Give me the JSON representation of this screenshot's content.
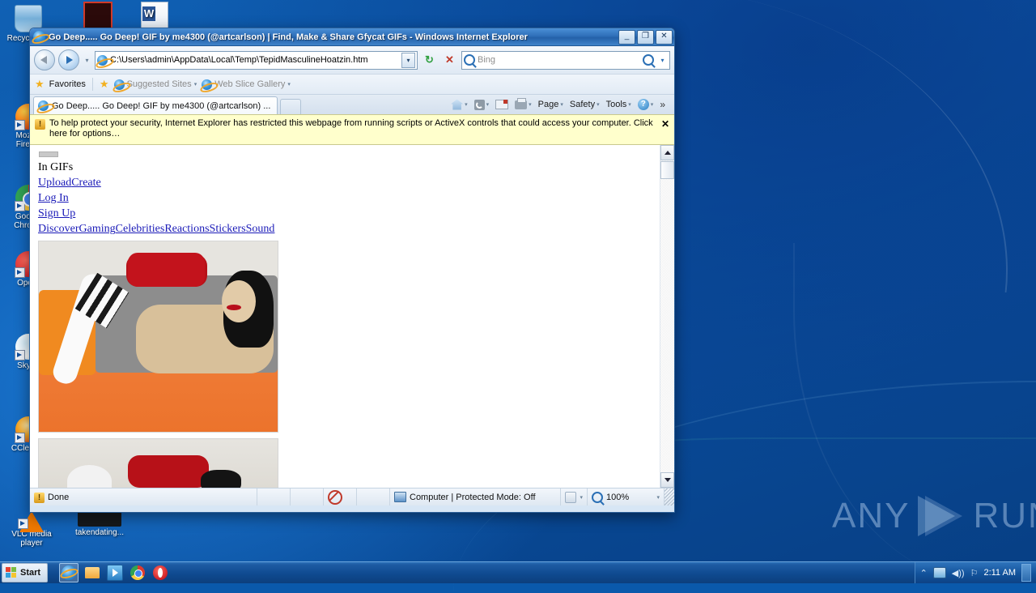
{
  "window": {
    "title": "Go Deep..... Go Deep! GIF by me4300 (@artcarlson) | Find, Make & Share Gfycat GIFs - Windows Internet Explorer",
    "minimize_label": "_",
    "maximize_label": "❐",
    "close_label": "✕"
  },
  "toolbar": {
    "back_tooltip": "Back",
    "forward_tooltip": "Forward",
    "recent_pages_caret": "▾",
    "address_value": "C:\\Users\\admin\\AppData\\Local\\Temp\\TepidMasculineHoatzin.htm",
    "address_dropdown_caret": "▾",
    "refresh_label": "↻",
    "stop_label": "✕",
    "search_placeholder": "Bing",
    "search_dropdown_caret": "▾"
  },
  "favorites_bar": {
    "favorites_label": "Favorites",
    "suggested_sites_label": "Suggested Sites",
    "web_slice_label": "Web Slice Gallery",
    "caret": "▾"
  },
  "tabs": [
    {
      "label": "Go Deep..... Go Deep! GIF by me4300 (@artcarlson) ..."
    }
  ],
  "command_bar": {
    "home_label": "",
    "feeds_label": "",
    "mail_label": "",
    "print_label": "",
    "page_label": "Page",
    "safety_label": "Safety",
    "tools_label": "Tools",
    "help_label": "?",
    "overflow_label": "»",
    "caret": "▾"
  },
  "information_bar": {
    "text": "To help protect your security, Internet Explorer has restricted this webpage from running scripts or ActiveX controls that could access your computer. Click here for options…",
    "close_label": "✕"
  },
  "page_content": {
    "line_in_gifs": "In GIFs",
    "links_row2": [
      "Upload",
      "Create"
    ],
    "link_log_in": "Log In",
    "link_sign_up": "Sign Up",
    "nav_links": [
      "Discover",
      "Gaming",
      "Celebrities",
      "Reactions",
      "Stickers",
      "Sound"
    ],
    "media_alt_1": "embedded GIF preview",
    "media_alt_2": "embedded GIF preview (second frame)"
  },
  "scrollbar": {
    "up_label": "▲",
    "down_label": "▼"
  },
  "status_bar": {
    "status_text": "Done",
    "blocked_tooltip": "blocked content",
    "zone_text": "Computer | Protected Mode: Off",
    "zone_caret": "▾",
    "zoom_text": "100%",
    "zoom_caret": "▾"
  },
  "desktop_icons": [
    {
      "label": "Recycle Bin",
      "icon": "recycle-bin-icon",
      "shortcut": false
    },
    {
      "label": "Mozilla Firefox",
      "icon": "firefox-icon",
      "shortcut": true
    },
    {
      "label": "Google Chrome",
      "icon": "chrome-icon",
      "shortcut": true
    },
    {
      "label": "Opera",
      "icon": "opera-icon",
      "shortcut": true
    },
    {
      "label": "Skype",
      "icon": "skype-icon",
      "shortcut": true
    },
    {
      "label": "CCleaner",
      "icon": "ccleaner-icon",
      "shortcut": true
    },
    {
      "label": "VLC media player",
      "icon": "vlc-icon",
      "shortcut": true
    },
    {
      "label": "takendating...",
      "icon": "unknown-file-icon",
      "shortcut": false
    },
    {
      "label": "",
      "icon": "acrobat-reader-icon",
      "shortcut": false
    },
    {
      "label": "",
      "icon": "word-document-icon",
      "shortcut": false
    }
  ],
  "taskbar": {
    "start_label": "Start",
    "quick_launch": [
      {
        "name": "internet-explorer",
        "active": true
      },
      {
        "name": "windows-explorer",
        "active": false
      },
      {
        "name": "media-player",
        "active": false
      },
      {
        "name": "google-chrome",
        "active": false
      },
      {
        "name": "opera",
        "active": false
      }
    ],
    "tray": {
      "expand_label": "⌃",
      "network_label": "",
      "volume_label": "◀))",
      "flag_label": "⚐",
      "clock": "2:11 AM"
    }
  },
  "watermark": {
    "left": "ANY",
    "right": "RUN"
  },
  "colors": {
    "title_blue": "#2f6fb9",
    "infobar_yellow": "#ffffcc",
    "link_blue": "#1a1ab8",
    "desktop_blue": "#0b55a8"
  }
}
